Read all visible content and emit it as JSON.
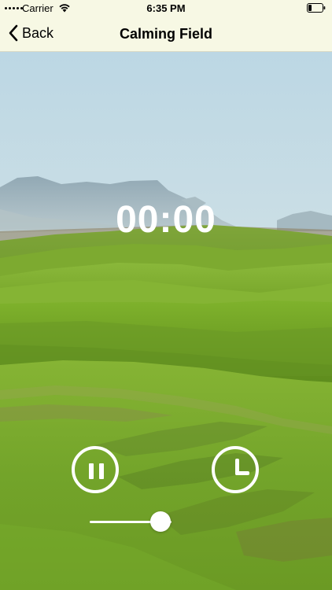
{
  "status_bar": {
    "carrier": "Carrier",
    "time": "6:35 PM",
    "icons": [
      "signal-dots-icon",
      "wifi-icon",
      "battery-icon"
    ]
  },
  "nav": {
    "back_label": "Back",
    "title": "Calming Field"
  },
  "player": {
    "timer": "00:00",
    "pause_icon": "pause-icon",
    "timer_icon": "clock-icon",
    "volume_level": 0.9
  },
  "colors": {
    "bar_background": "#f7f8e4",
    "control_color": "#ffffff"
  }
}
